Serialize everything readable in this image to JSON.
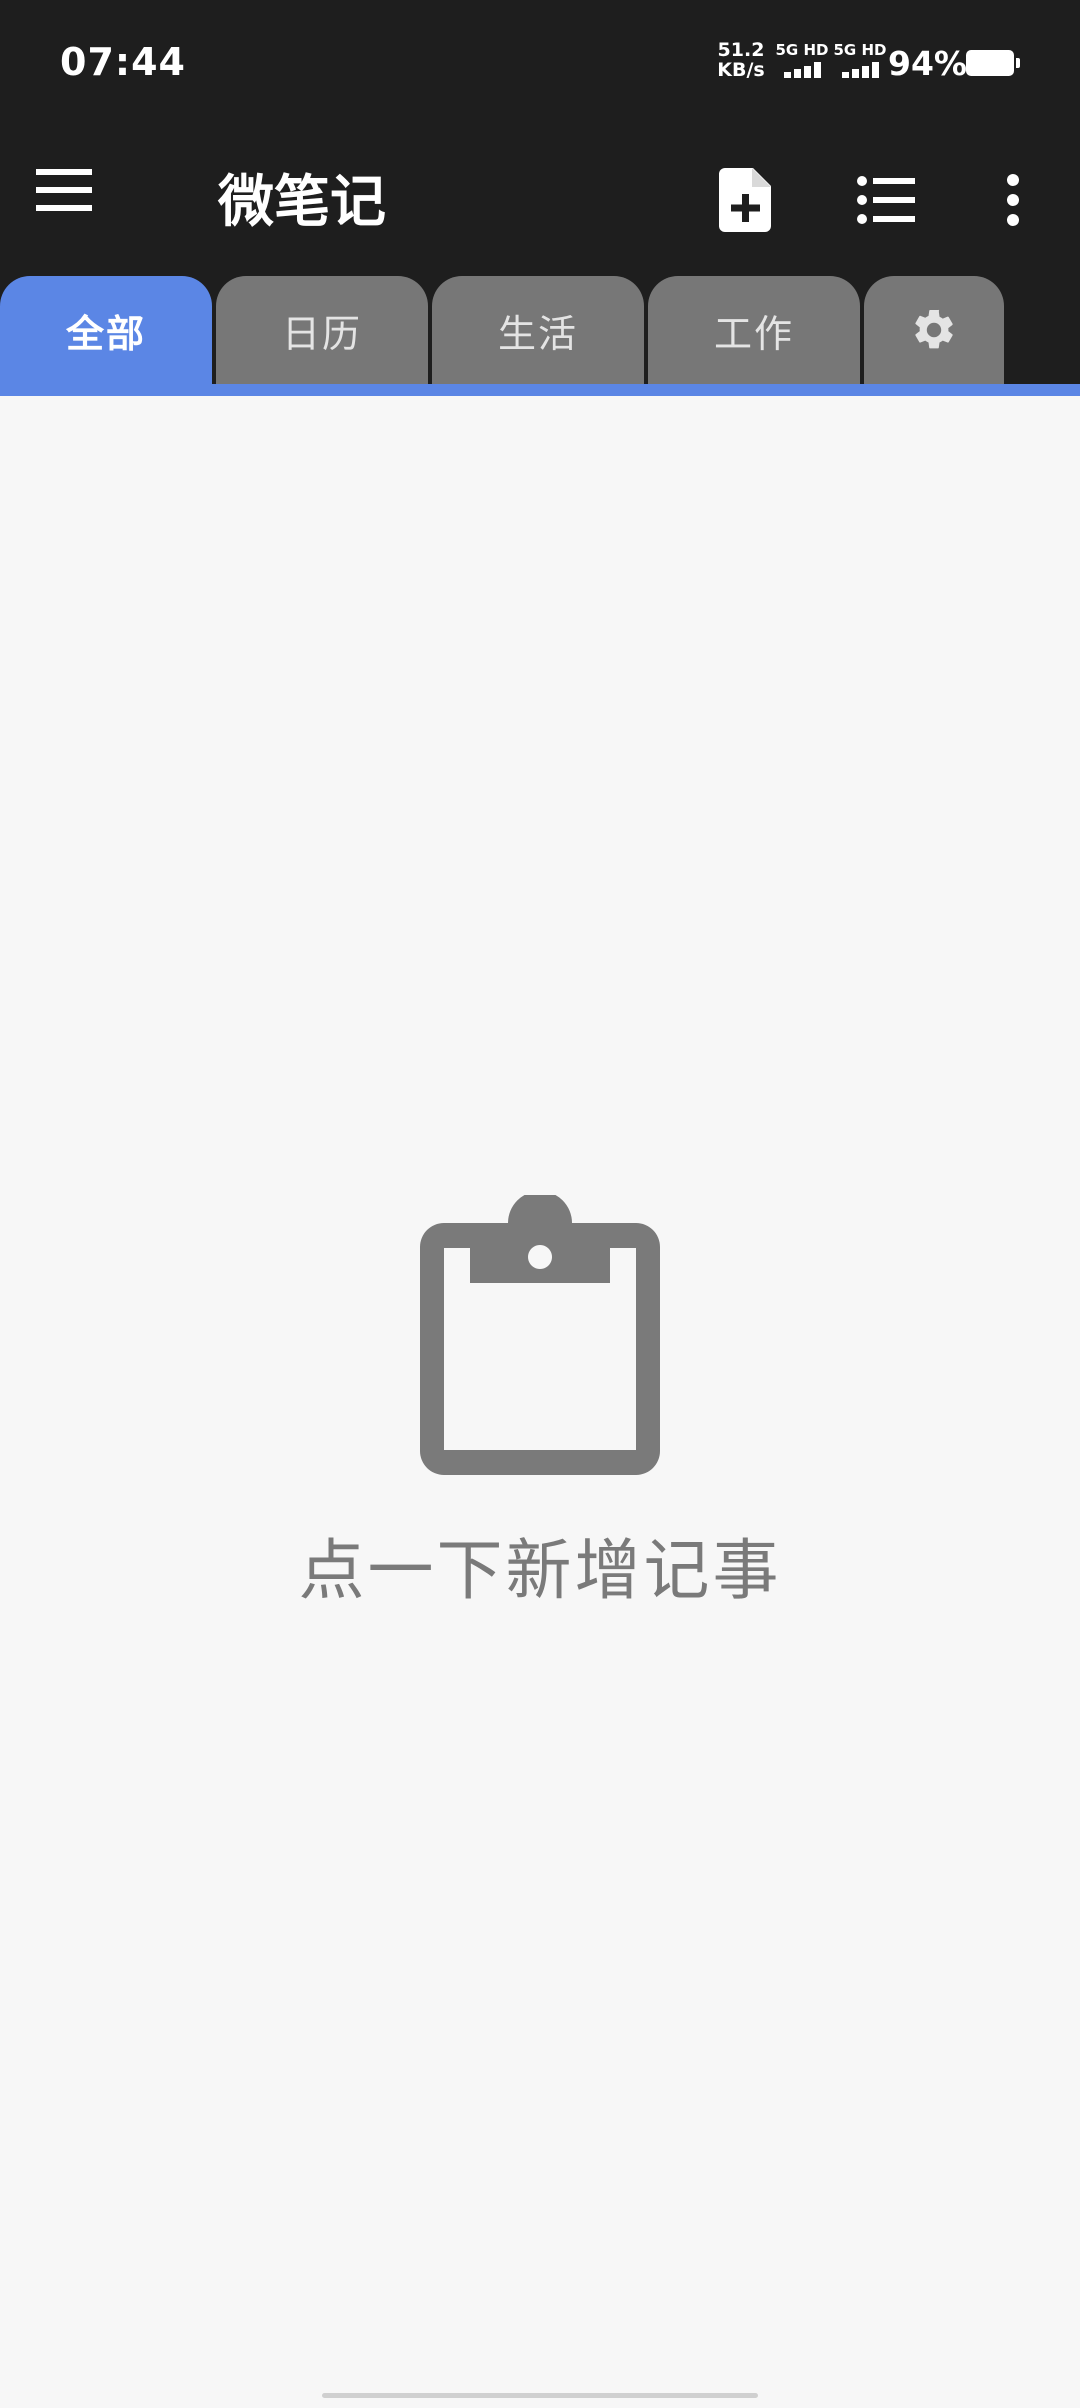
{
  "status_bar": {
    "time": "07:44",
    "speed_value": "51.2",
    "speed_unit": "KB/s",
    "sim1_label": "5G HD",
    "sim2_label": "5G HD",
    "battery_percent": "94%"
  },
  "app_bar": {
    "title": "微笔记"
  },
  "tabs": [
    {
      "label": "全部",
      "active": true
    },
    {
      "label": "日历",
      "active": false
    },
    {
      "label": "生活",
      "active": false
    },
    {
      "label": "工作",
      "active": false
    }
  ],
  "empty_state": {
    "message": "点一下新增记事"
  },
  "colors": {
    "header_bg": "#1e1e1e",
    "accent": "#5b86e5",
    "tab_inactive": "#777777",
    "body_bg": "#f7f7f7",
    "empty_gray": "#7a7a7a"
  },
  "icons": {
    "menu": "hamburger-menu-icon",
    "new_note": "new-note-icon",
    "list_view": "list-view-icon",
    "more": "more-vertical-icon",
    "settings_tab": "gear-icon",
    "empty": "clipboard-icon"
  }
}
